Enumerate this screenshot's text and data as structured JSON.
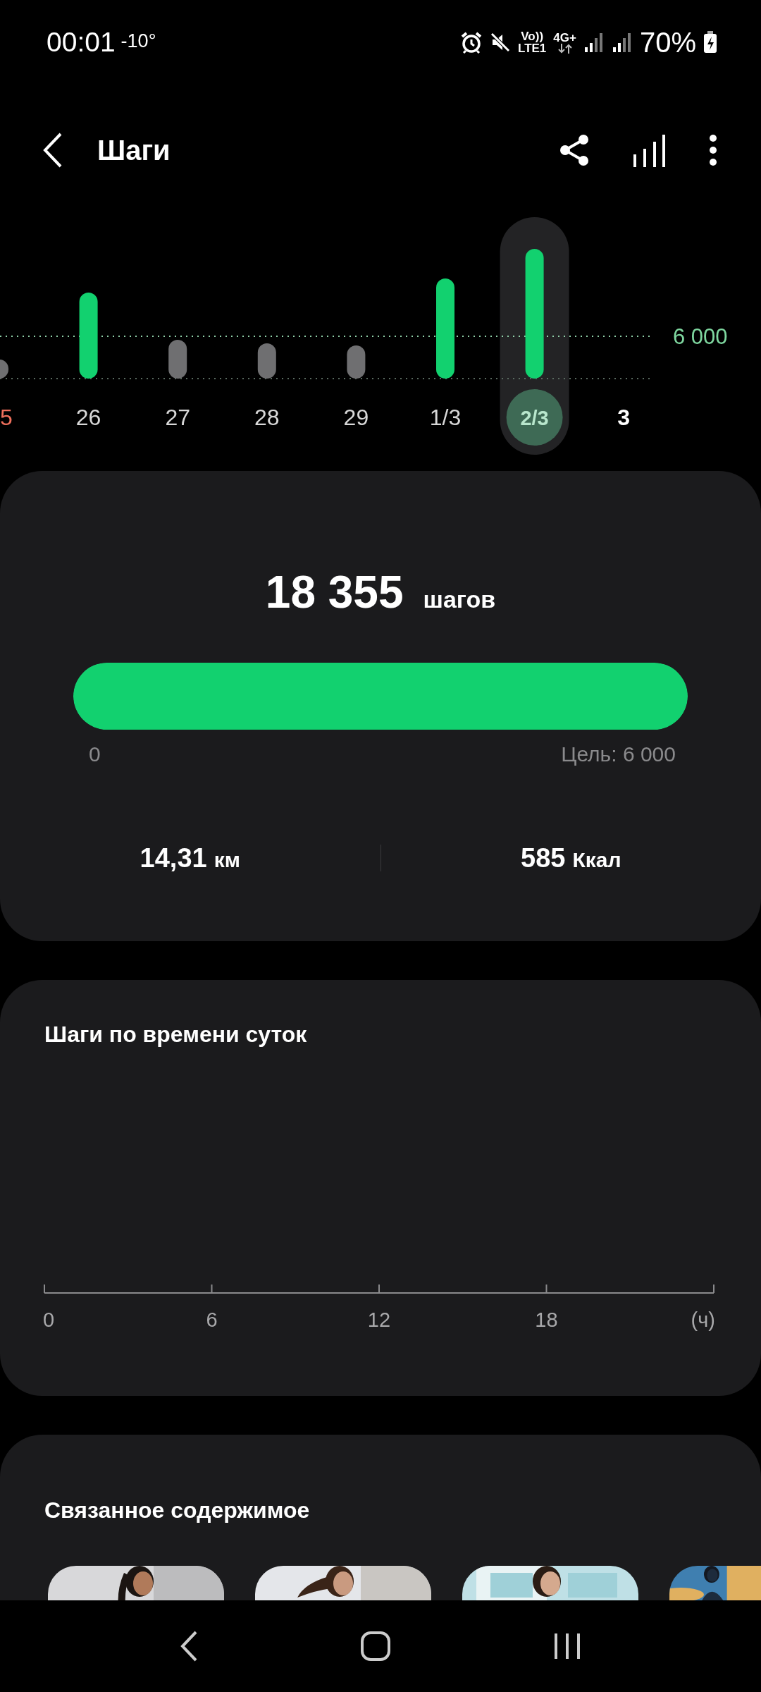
{
  "status_bar": {
    "time": "00:01",
    "temperature": "-10°",
    "volte": "Vo))",
    "volte_sim": "LTE1",
    "network": "4G+",
    "battery": "70%"
  },
  "app_bar": {
    "title": "Шаги"
  },
  "daily_chart": {
    "goal_label": "6 000",
    "days": [
      {
        "label": "5",
        "kind": "weekend",
        "selected": false
      },
      {
        "label": "26",
        "kind": "past",
        "selected": false
      },
      {
        "label": "27",
        "kind": "past",
        "selected": false
      },
      {
        "label": "28",
        "kind": "past",
        "selected": false
      },
      {
        "label": "29",
        "kind": "past",
        "selected": false
      },
      {
        "label": "1/3",
        "kind": "past",
        "selected": false
      },
      {
        "label": "2/3",
        "kind": "past",
        "selected": true
      },
      {
        "label": "3",
        "kind": "today",
        "selected": false
      }
    ]
  },
  "summary": {
    "steps": "18 355",
    "steps_unit": "шагов",
    "level": 1,
    "scale_min": "0",
    "goal": "Цель: 6 000",
    "distance": "14,31",
    "distance_unit": "км",
    "calories": "585",
    "calories_unit": "Ккал"
  },
  "hourly": {
    "title": "Шаги по времени суток",
    "axis_labels": [
      "0",
      "6",
      "12",
      "18",
      "(ч)"
    ]
  },
  "related": {
    "title": "Связанное содержимое"
  }
}
